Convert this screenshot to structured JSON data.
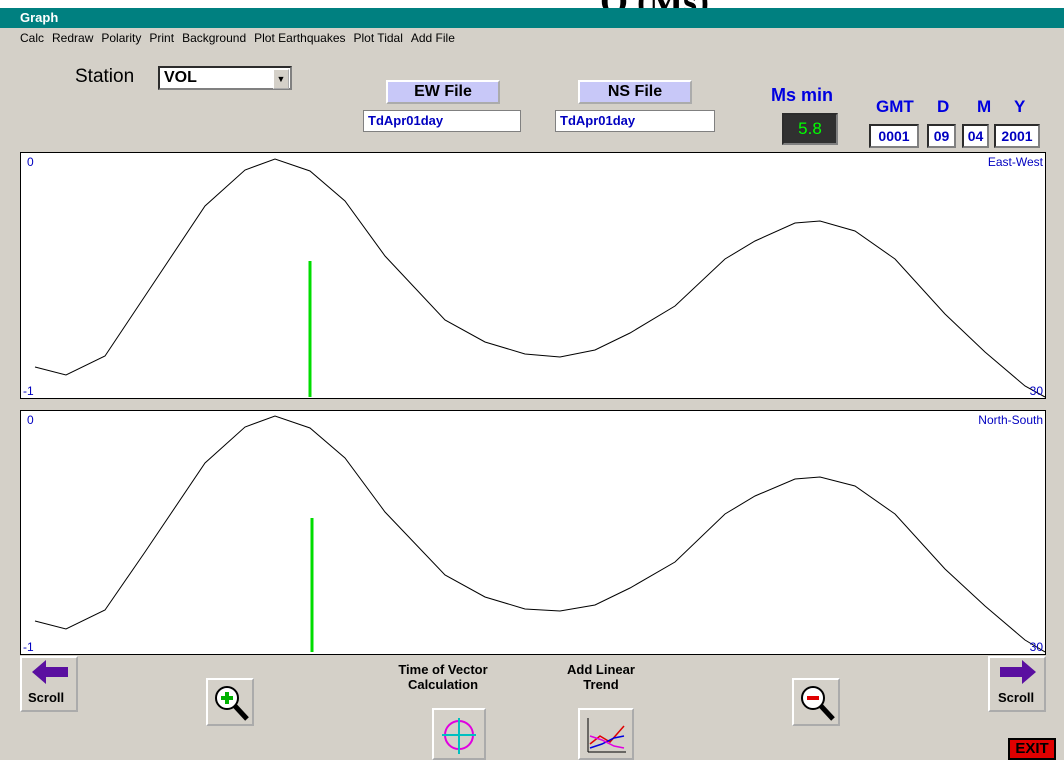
{
  "window": {
    "title": "Graph"
  },
  "menu": [
    "Calc",
    "Redraw",
    "Polarity",
    "Print",
    "Background",
    "Plot Earthquakes",
    "Plot Tidal",
    "Add File"
  ],
  "station": {
    "label": "Station",
    "value": "VOL"
  },
  "ew": {
    "button": "EW File",
    "value": "TdApr01day"
  },
  "ns": {
    "button": "NS File",
    "value": "TdApr01day"
  },
  "ms": {
    "label": "Ms min",
    "value": "5.8"
  },
  "date": {
    "headers": {
      "gmt": "GMT",
      "d": "D",
      "m": "M",
      "y": "Y"
    },
    "gmt": "0001",
    "d": "09",
    "m": "04",
    "y": "2001"
  },
  "plots": [
    {
      "name": "East-West",
      "y_top_label": "0",
      "x_start_label": "-1",
      "x_end_label": "30"
    },
    {
      "name": "North-South",
      "y_top_label": "0",
      "x_start_label": "-1",
      "x_end_label": "30"
    }
  ],
  "bottom": {
    "scroll_left": "Scroll",
    "scroll_right": "Scroll",
    "vector_caption_1": "Time of Vector",
    "vector_caption_2": "Calculation",
    "trend_caption_1": "Add Linear",
    "trend_caption_2": "Trend",
    "exit": "EXIT"
  },
  "icons": {
    "scroll_left": "left-arrow-icon",
    "scroll_right": "right-arrow-icon",
    "zoom_in": "zoom-in-icon",
    "zoom_out": "zoom-out-icon",
    "vector": "vector-calc-icon",
    "trend": "linear-trend-icon"
  },
  "colors": {
    "titlebar": "#008080",
    "window": "#d4d0c8",
    "curve": "#000000",
    "marker": "#00dd00",
    "label_blue": "#0000c0"
  }
}
